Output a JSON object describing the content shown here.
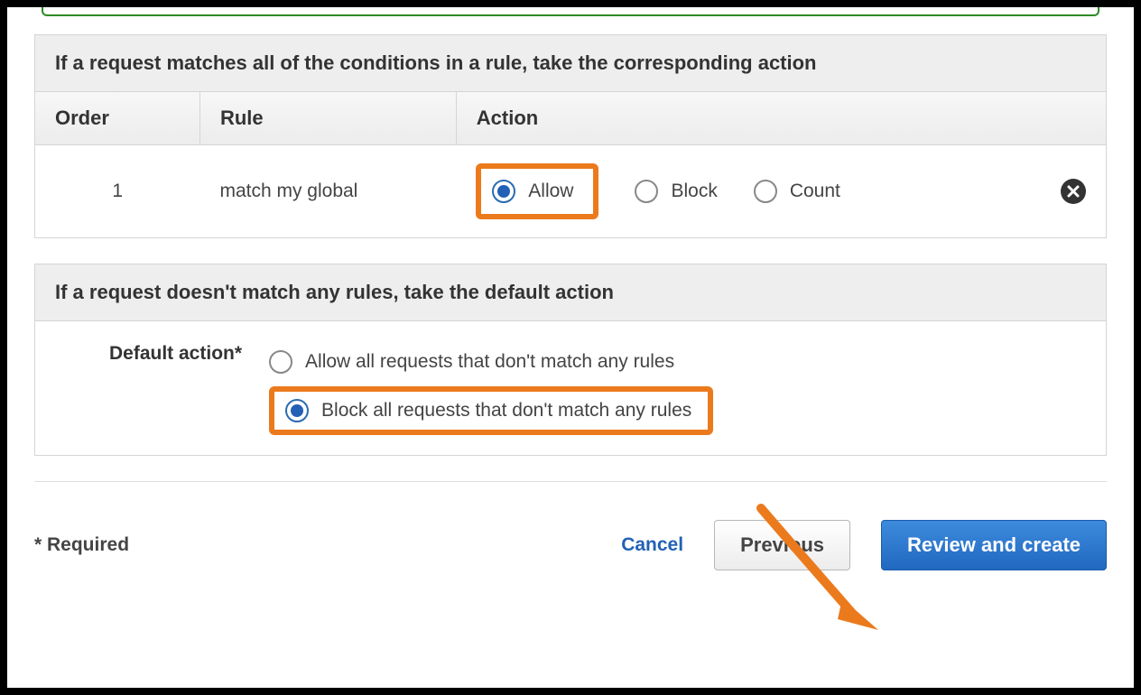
{
  "panel1": {
    "title": "If a request matches all of the conditions in a rule, take the corresponding action",
    "table": {
      "headers": {
        "order": "Order",
        "rule": "Rule",
        "action": "Action"
      },
      "rows": [
        {
          "order": "1",
          "rule": "match my global",
          "actions": {
            "allow": {
              "label": "Allow",
              "selected": true
            },
            "block": {
              "label": "Block",
              "selected": false
            },
            "count": {
              "label": "Count",
              "selected": false
            }
          },
          "remove_icon": "x-icon"
        }
      ]
    }
  },
  "panel2": {
    "title": "If a request doesn't match any rules, take the default action",
    "default_action": {
      "label": "Default action*",
      "options": [
        {
          "id": "allow",
          "label": "Allow all requests that don't match any rules",
          "selected": false
        },
        {
          "id": "block",
          "label": "Block all requests that don't match any rules",
          "selected": true
        }
      ]
    }
  },
  "footer": {
    "required_note": "* Required",
    "cancel": "Cancel",
    "previous": "Previous",
    "review_create": "Review and create"
  },
  "annotations": {
    "highlight_color": "#eb7a1d",
    "arrow_icon": "arrow-icon"
  }
}
